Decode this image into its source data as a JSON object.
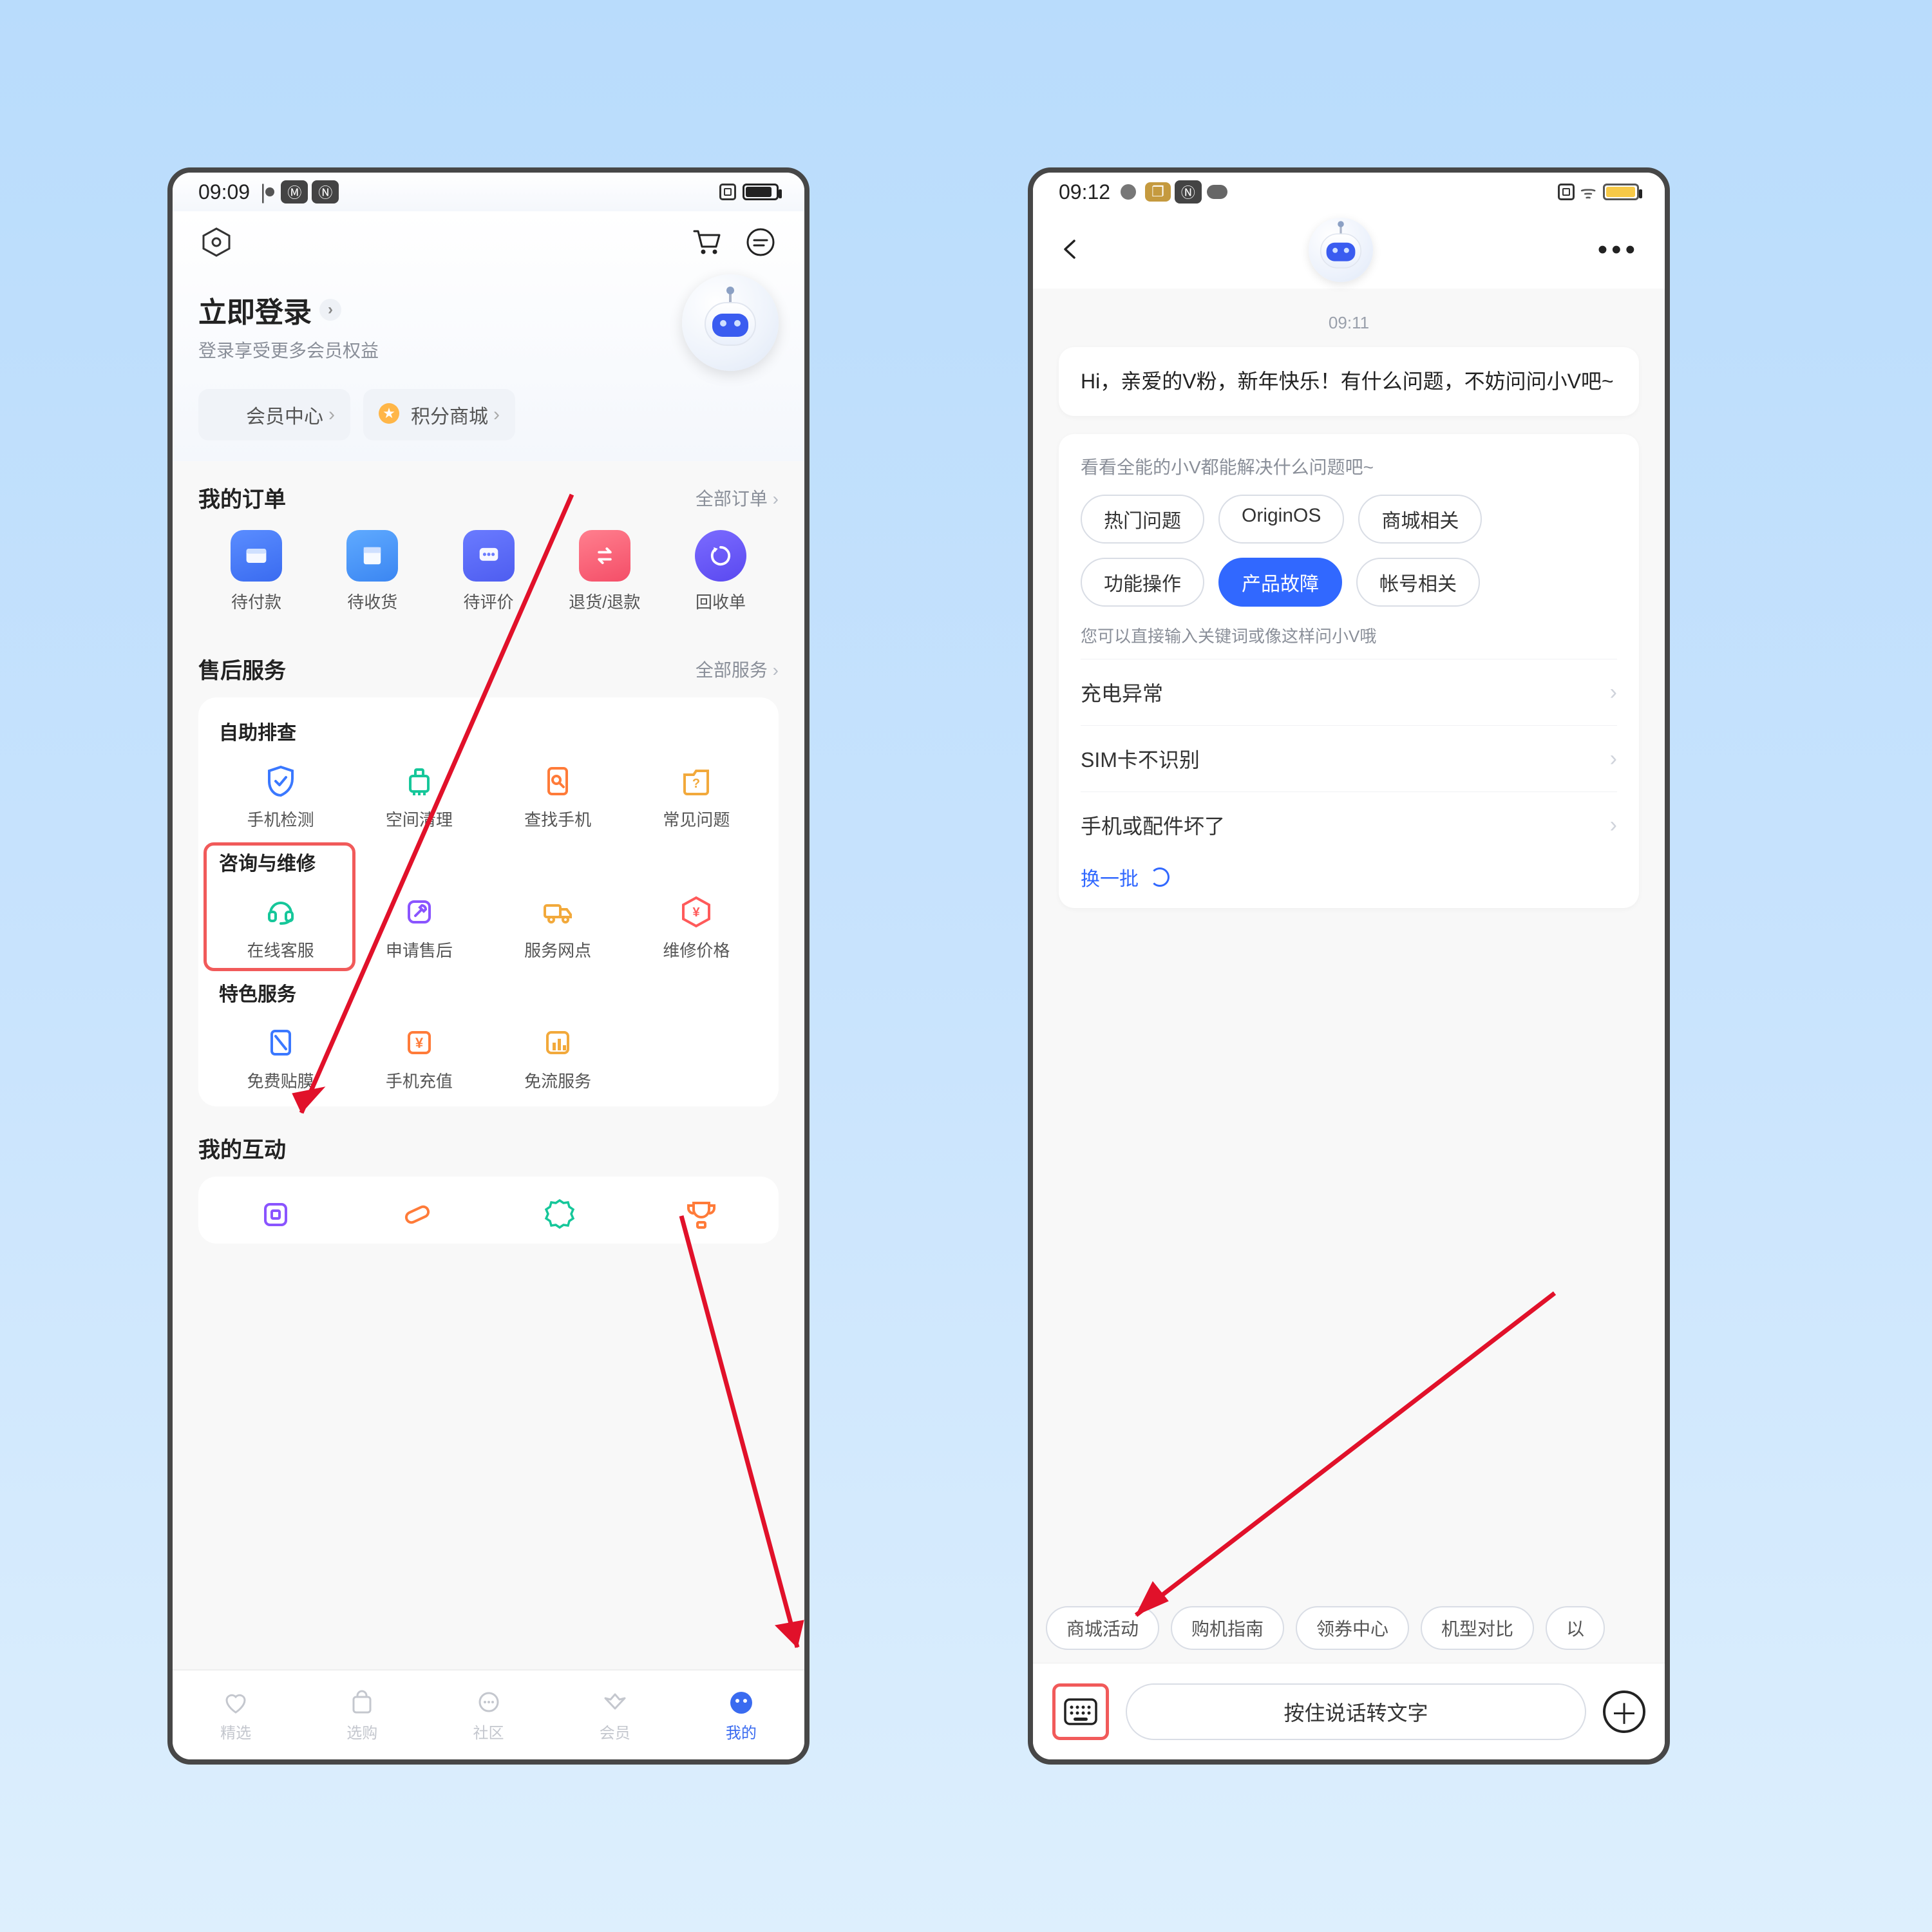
{
  "left": {
    "status_time": "09:09",
    "hex_icon": "settings-hexagon",
    "login_title": "立即登录",
    "login_sub": "登录享受更多会员权益",
    "chip_member": "会员中心",
    "chip_points": "积分商城",
    "orders_title": "我的订单",
    "orders_more": "全部订单",
    "orders": [
      "待付款",
      "待收货",
      "待评价",
      "退货/退款",
      "回收单"
    ],
    "aftersale_title": "售后服务",
    "aftersale_more": "全部服务",
    "g1_title": "自助排查",
    "g1": [
      "手机检测",
      "空间清理",
      "查找手机",
      "常见问题"
    ],
    "g2_title": "咨询与维修",
    "g2": [
      "在线客服",
      "申请售后",
      "服务网点",
      "维修价格"
    ],
    "g3_title": "特色服务",
    "g3": [
      "免费贴膜",
      "手机充值",
      "免流服务"
    ],
    "interact_title": "我的互动",
    "tabs": [
      "精选",
      "选购",
      "社区",
      "会员",
      "我的"
    ]
  },
  "right": {
    "status_time": "09:12",
    "chat_time": "09:11",
    "greeting": "Hi，亲爱的V粉，新年快乐！有什么问题，不妨问问小V吧~",
    "faq_hint": "看看全能的小V都能解决什么问题吧~",
    "tags": [
      "热门问题",
      "OriginOS",
      "商城相关",
      "功能操作",
      "产品故障",
      "帐号相关"
    ],
    "active_tag_index": 4,
    "hint2": "您可以直接输入关键词或像这样问小V哦",
    "questions": [
      "充电异常",
      "SIM卡不识别",
      "手机或配件坏了"
    ],
    "refresh": "换一批",
    "quick": [
      "商城活动",
      "购机指南",
      "领券中心",
      "机型对比",
      "以"
    ],
    "voice_label": "按住说话转文字"
  }
}
